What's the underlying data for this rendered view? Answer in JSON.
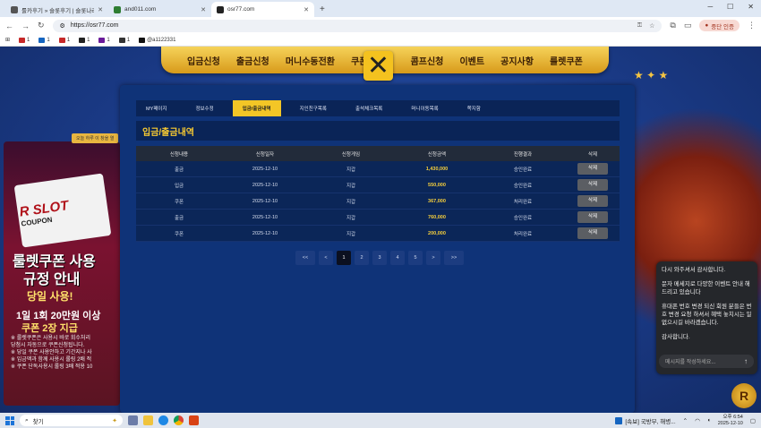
{
  "browser": {
    "tabs": [
      {
        "label": "룰카후기 » 슬롯후기 | 슬롯나라",
        "active": false
      },
      {
        "label": "and011.com",
        "active": false
      },
      {
        "label": "osr77.com",
        "active": true
      }
    ],
    "new_tab": "+",
    "window_controls": [
      "─",
      "☐",
      "✕"
    ],
    "url": "https://osr77.com",
    "profile_label": "중단 인증",
    "bookmarks": [
      "1",
      "1",
      "1",
      "1",
      "1",
      "1",
      "@a1122331"
    ]
  },
  "site": {
    "nav": [
      "입금신청",
      "출금신청",
      "머니수동전환",
      "쿠폰",
      "콤프신청",
      "이벤트",
      "공지사항",
      "룰렛쿠폰"
    ],
    "close_symbol": "✕",
    "banner": {
      "notice": "오늘 하루 이 창을 열",
      "coupon_title": "R SLOT",
      "coupon_sub": "COUPON",
      "line1": "룰렛쿠폰 사용",
      "line2": "규정 안내",
      "line3": "당일 사용!",
      "line4": "1일 1회 20만원 이상",
      "line5": "쿠폰 2장 지급",
      "small": [
        "※ 룰렛쿠폰은 사용시 바로 회수처리",
        "   당첨시 자동으로 쿠폰신청됩니다.",
        "※ 당일 쿠폰 사용안하고 기간지나 사",
        "※ 입금액과 함께 사용시 롤링 2배 적",
        "※ 쿠폰 단독사용시 롤링 3배 적용 10"
      ]
    },
    "subtabs": [
      "MY페이지",
      "정보수정",
      "입금/출금내역",
      "지인친구목록",
      "출석체크목록",
      "머니이동목록",
      "쪽지함"
    ],
    "active_subtab": 2,
    "page_title": "입금/출금내역",
    "table": {
      "headers": [
        "신청내용",
        "신청일자",
        "신청게임",
        "신청금액",
        "진행결과",
        "삭제"
      ],
      "rows": [
        [
          "출금",
          "2025-12-10",
          "지갑",
          "1,430,000",
          "승인완료",
          "삭제"
        ],
        [
          "입금",
          "2025-12-10",
          "지갑",
          "550,000",
          "승인완료",
          "삭제"
        ],
        [
          "쿠폰",
          "2025-12-10",
          "지갑",
          "367,000",
          "처리완료",
          "삭제"
        ],
        [
          "출금",
          "2025-12-10",
          "지갑",
          "760,000",
          "승인완료",
          "삭제"
        ],
        [
          "쿠폰",
          "2025-12-10",
          "지갑",
          "200,000",
          "처리완료",
          "삭제"
        ]
      ]
    },
    "pager": [
      "<<",
      "<",
      "1",
      "2",
      "3",
      "4",
      "5",
      ">",
      ">>"
    ],
    "pager_active": 2
  },
  "chat": {
    "messages": [
      "다시 와주셔서 감사합니다.",
      "문자 메세지로 다양한 이벤트 안내 해드리고 있습니다",
      "휴대폰 번호 변경 되신 회원 분들은 번호 변경 요청 하셔서 혜택 놓치시는 일 없으시길 바라겠습니다.",
      "감사합니다."
    ],
    "input_placeholder": "메시지를 작성하세요...",
    "send": "↑"
  },
  "taskbar": {
    "search": "찾기",
    "news": "[속보] 국방부, 해병...",
    "time": "오후 6:54",
    "date": "2025-12-10"
  },
  "colors": {
    "accent": "#f3c626",
    "panel": "#0f3378",
    "amount": "#f6cf3c"
  }
}
